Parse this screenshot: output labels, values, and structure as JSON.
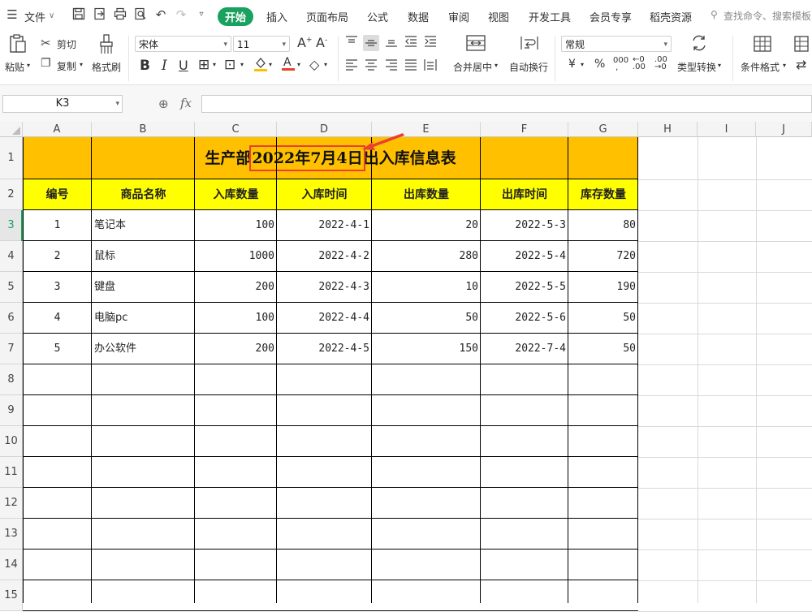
{
  "menu": {
    "file": "文件",
    "tabs": [
      "开始",
      "插入",
      "页面布局",
      "公式",
      "数据",
      "审阅",
      "视图",
      "开发工具",
      "会员专享",
      "稻壳资源"
    ],
    "search_placeholder": "查找命令、搜索模板"
  },
  "ribbon": {
    "paste": "粘贴",
    "cut": "剪切",
    "copy": "复制",
    "format_painter": "格式刷",
    "font_name": "宋体",
    "font_size": "11",
    "merge_center": "合并居中",
    "wrap_text": "自动换行",
    "number_format": "常规",
    "type_convert": "类型转换",
    "conditional_format": "条件格式",
    "currency": "¥",
    "percent": "%"
  },
  "formula_bar": {
    "name_box": "K3",
    "fx": "fx",
    "value": ""
  },
  "sheet": {
    "columns": [
      "A",
      "B",
      "C",
      "D",
      "E",
      "F",
      "G",
      "H",
      "I",
      "J"
    ],
    "rows": [
      "1",
      "2",
      "3",
      "4",
      "5",
      "6",
      "7",
      "8",
      "9",
      "10",
      "11",
      "12",
      "13",
      "14",
      "15"
    ],
    "title_prefix": "生产部",
    "title_date": "2022年7月4日",
    "title_suffix": "出入库信息表",
    "headers": [
      "编号",
      "商品名称",
      "入库数量",
      "入库时间",
      "出库数量",
      "出库时间",
      "库存数量"
    ],
    "data": [
      [
        "1",
        "笔记本",
        "100",
        "2022-4-1",
        "20",
        "2022-5-3",
        "80"
      ],
      [
        "2",
        "鼠标",
        "1000",
        "2022-4-2",
        "280",
        "2022-5-4",
        "720"
      ],
      [
        "3",
        "键盘",
        "200",
        "2022-4-3",
        "10",
        "2022-5-5",
        "190"
      ],
      [
        "4",
        "电脑pc",
        "100",
        "2022-4-4",
        "50",
        "2022-5-6",
        "50"
      ],
      [
        "5",
        "办公软件",
        "200",
        "2022-4-5",
        "150",
        "2022-7-4",
        "50"
      ]
    ],
    "colors": {
      "title_fill": "#ffc000",
      "header_fill": "#ffff00",
      "highlight_box": "#e8412c",
      "active_tab": "#19a15f"
    }
  }
}
